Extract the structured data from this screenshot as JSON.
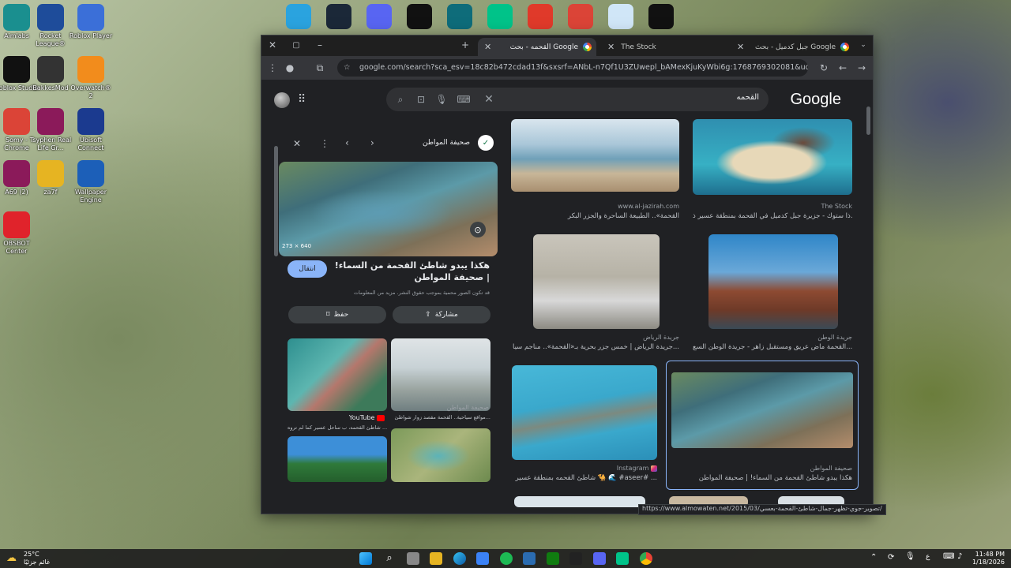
{
  "desktop": {
    "left_icons": [
      {
        "label": "Aimlabs",
        "icon": "aimlabs-icon",
        "color": "#1a8f8f"
      },
      {
        "label": "Rocket League®",
        "icon": "rocket-league-icon",
        "color": "#1e4c9a"
      },
      {
        "label": "Roblox Player",
        "icon": "roblox-player-icon",
        "color": "#3b6fd8"
      },
      {
        "label": "Roblox Studio",
        "icon": "roblox-studio-icon",
        "color": "#111"
      },
      {
        "label": "BakkesMod",
        "icon": "bakkesmod-icon",
        "color": "#333"
      },
      {
        "label": "Overwatch® 2",
        "icon": "overwatch-icon",
        "color": "#f28c1c"
      },
      {
        "label": "Somy - Chrome",
        "icon": "chrome-icon",
        "color": "#db4437"
      },
      {
        "label": "Tsyphen Real Life Gr...",
        "icon": "winrar-icon",
        "color": "#8b1a5a"
      },
      {
        "label": "Ubisoft Connect",
        "icon": "ubisoft-icon",
        "color": "#1b3a8f"
      },
      {
        "label": "A69 (2)",
        "icon": "winrar-icon",
        "color": "#8b1a5a"
      },
      {
        "label": "za7f",
        "icon": "folder-icon",
        "color": "#e6b422"
      },
      {
        "label": "Wallpaper Engine",
        "icon": "wallpaper-engine-icon",
        "color": "#1c5fb8"
      },
      {
        "label": "OBSBOT Center",
        "icon": "obsbot-icon",
        "color": "#e0232b"
      }
    ],
    "top_icons": [
      {
        "icon": "telegram-icon",
        "color": "#2aa3df"
      },
      {
        "icon": "steam-icon",
        "color": "#1b2838"
      },
      {
        "icon": "discord-icon",
        "color": "#5865f2"
      },
      {
        "icon": "app-icon",
        "color": "#111"
      },
      {
        "icon": "diamond-icon",
        "color": "#0e6c7a"
      },
      {
        "icon": "game-icon",
        "color": "#00c389"
      },
      {
        "icon": "faceit-icon",
        "color": "#e03a2a"
      },
      {
        "icon": "chrome-icon",
        "color": "#db4437"
      },
      {
        "icon": "recycle-bin-icon",
        "color": "#d0e6f7"
      },
      {
        "icon": "capcut-icon",
        "color": "#111"
      }
    ]
  },
  "browser": {
    "tabs": [
      {
        "title": "The Stock",
        "active": false
      },
      {
        "title": "القحمه - بحث Google",
        "active": true
      },
      {
        "title": "جبل كدميل - بحث Google",
        "active": false
      }
    ],
    "new_tab": "+",
    "url": "google.com/search?sca_esv=18c82b472cdad13f&sxsrf=ANbL-n7Qf1U3ZUwepl_bAMexKjuKyWbi6g:1768769302081&udm=2&fbs..."
  },
  "google": {
    "logo": "Google",
    "query": "القحمه"
  },
  "preview": {
    "source": "صحيفة المواطن",
    "dimensions": "273 × 640",
    "title": "هكذا يبدو شاطئ القحمة من السماء! | صحيفة المواطن",
    "notice": "قد تكون الصور محمية بموجب حقوق النشر. مزيد من المعلومات",
    "visit": "انتقال",
    "share": "مشاركة",
    "save": "حفظ",
    "related": [
      {
        "source": "YouTube",
        "caption": "شاطئ القحمه، ب ساحل عسير كما لم تروه ..."
      },
      {
        "source": "صحيفة المواطن",
        "caption": "مواقع سياحية.. القحمة مقصد زوار شواطئ..."
      }
    ]
  },
  "results": [
    {
      "source": "www.al-jazirah.com",
      "caption": "القحمة».. الطبيعة الساحرة والجزر البكر"
    },
    {
      "source": "The Stock",
      "caption": "ذا ستوك - جزيرة جبل كدميل في القحمة بمنطقة عسير ذ..."
    },
    {
      "source": "جريدة الرياض",
      "caption": "جريدة الرياض | خمس جزر بحرية بـ«القحمة».. مناجم سيا..."
    },
    {
      "source": "جريدة الوطن",
      "caption": "القحمة ماض عريق ومستقبل زاهر - جريدة الوطن السع..."
    },
    {
      "source": "Instagram",
      "caption": "شاطئ القحمه بمنطقة عسير 🐪 🌊 #aseer# ..."
    },
    {
      "source": "صحيفة المواطن",
      "caption": "هكذا يبدو شاطئ القحمة من السماء! | صحيفة المواطن"
    }
  ],
  "status_url": "https://www.almowaten.net/2015/03/تصوير-جوي-تظهر-جمال-شاطئ-القحمة-بعسي/",
  "taskbar": {
    "weather_temp": "25°C",
    "weather_desc": "غائم جزئيًا",
    "lang": "ع",
    "time": "11:48 PM",
    "date": "1/18/2026"
  }
}
